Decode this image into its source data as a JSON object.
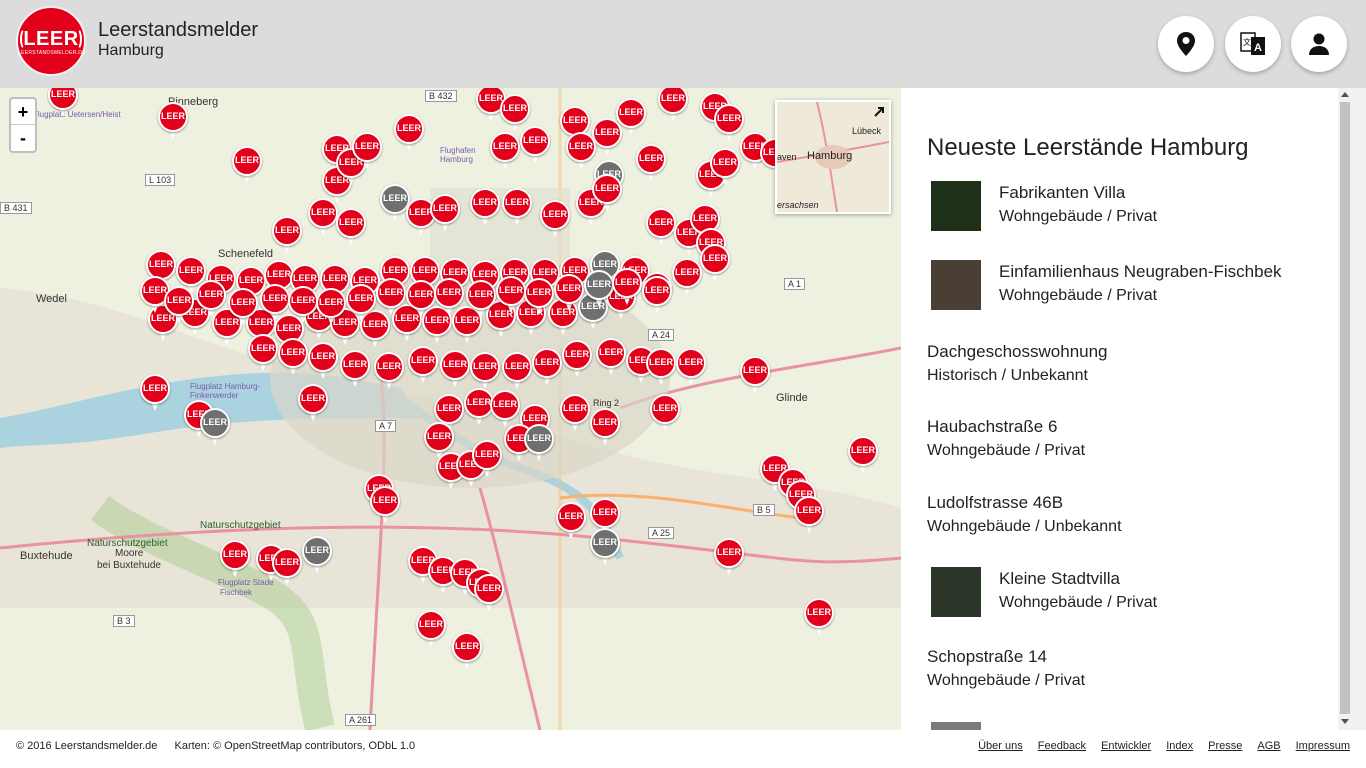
{
  "header": {
    "logo_text": "LEER",
    "logo_sub": "LEERSTANDSMELDER.DE",
    "title": "Leerstandsmelder",
    "city": "Hamburg",
    "buttons": [
      {
        "icon": "location-pin-icon"
      },
      {
        "icon": "translate-icon"
      },
      {
        "icon": "user-icon"
      }
    ]
  },
  "map": {
    "zoom_in": "+",
    "zoom_out": "-",
    "pin_label": "LEER",
    "places": [
      "Pinneberg",
      "Schenefeld",
      "Wedel",
      "Buxtehude",
      "Glinde",
      "Moore",
      "bei Buxtehude"
    ],
    "road_labels": [
      "B 432",
      "L 103",
      "B 431",
      "A 1",
      "A 24",
      "A 7",
      "A 25",
      "B 3",
      "A 261",
      "Ring 2",
      "B 5"
    ],
    "poi_labels": [
      "Flugplatz Uetersen/Heist",
      "Flughafen Hamburg",
      "Flugplatz Hamburg-Finkenwerder",
      "Naturschutzgebiet",
      "Naturschutzgebiet",
      "Flugplatz Stade",
      "Fischbek"
    ],
    "minimap_labels": [
      "Lübeck",
      "Hamburg",
      "aven",
      "ersachsen"
    ]
  },
  "sidebar": {
    "title": "Neueste Leerstände Hamburg",
    "entries": [
      {
        "name": "Fabrikanten Villa",
        "meta": "Wohngebäude / Privat",
        "has_thumb": true
      },
      {
        "name": "Einfamilienhaus Neugraben-Fischbek",
        "meta": "Wohngebäude / Privat",
        "has_thumb": true
      },
      {
        "name": "Dachgeschosswohnung",
        "meta": "Historisch / Unbekannt",
        "has_thumb": false
      },
      {
        "name": "Haubachstraße 6",
        "meta": "Wohngebäude / Privat",
        "has_thumb": false
      },
      {
        "name": "Ludolfstrasse 46B",
        "meta": "Wohngebäude / Unbekannt",
        "has_thumb": false
      },
      {
        "name": "Kleine Stadtvilla",
        "meta": "Wohngebäude / Privat",
        "has_thumb": true
      },
      {
        "name": "Schopstraße 14",
        "meta": "Wohngebäude / Privat",
        "has_thumb": false
      }
    ]
  },
  "footer": {
    "copyright": "© 2016 Leerstandsmelder.de",
    "maps": "Karten: © OpenStreetMap contributors, ODbL 1.0",
    "links": [
      "Über uns",
      "Feedback",
      "Entwickler",
      "Index",
      "Presse",
      "AGB",
      "Impressum"
    ]
  },
  "colors": {
    "brand_red": "#e2001a",
    "grey_pin": "#6f6f6f",
    "header_bg": "#dcdcdc"
  }
}
